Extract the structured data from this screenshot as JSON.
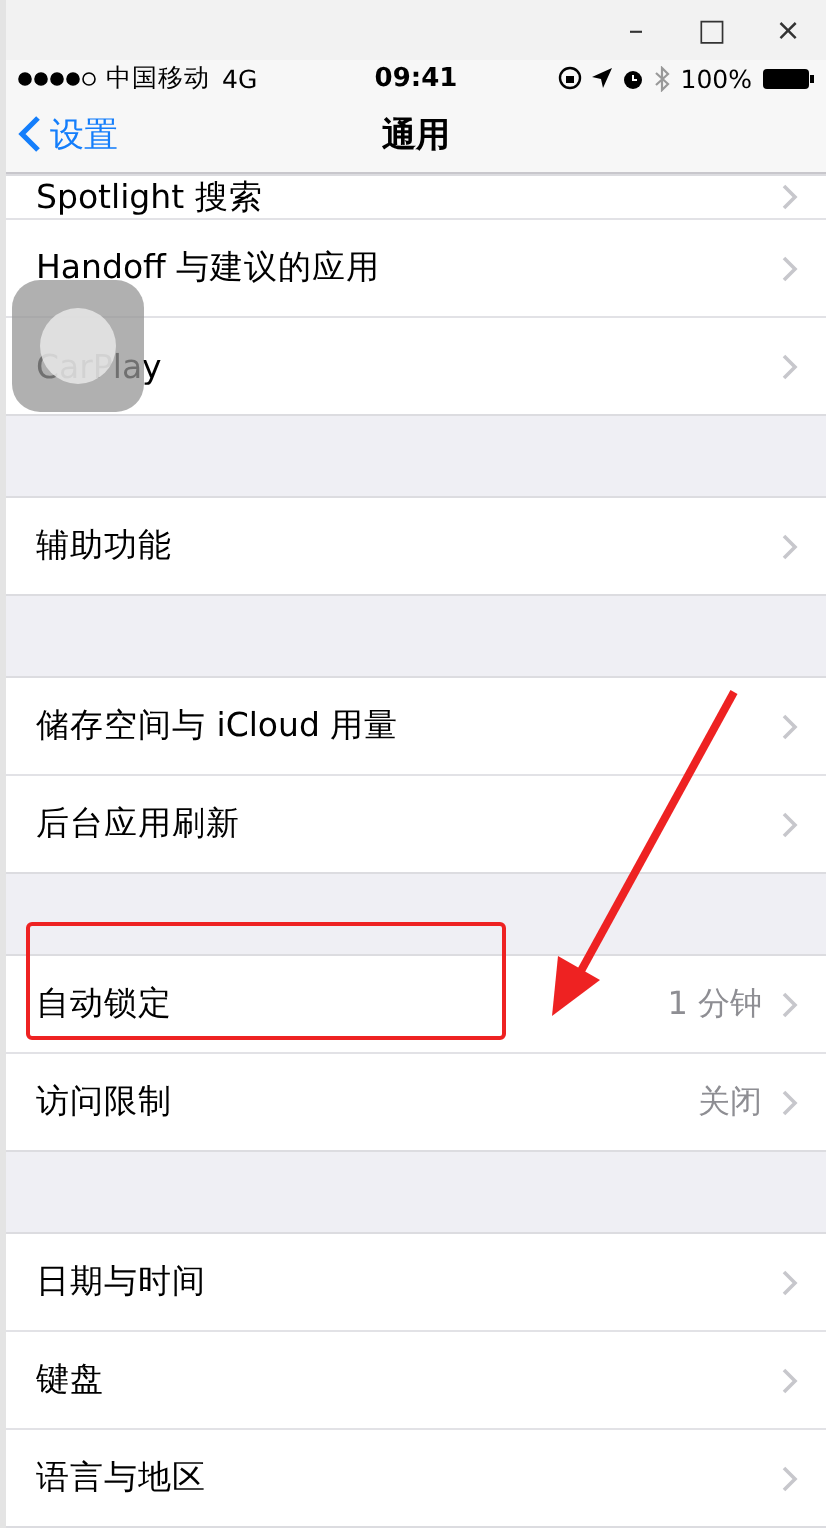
{
  "window": {
    "controls": [
      "–",
      "□",
      "×"
    ]
  },
  "status_bar": {
    "carrier": "中国移动",
    "network": "4G",
    "time": "09:41",
    "battery": "100%"
  },
  "nav_bar": {
    "back": "设置",
    "title": "通用"
  },
  "groups": [
    {
      "rows": [
        {
          "label": "Spotlight 搜索"
        },
        {
          "label": "Handoff 与建议的应用"
        },
        {
          "label": "CarPlay"
        }
      ]
    },
    {
      "rows": [
        {
          "label": "辅助功能"
        }
      ]
    },
    {
      "rows": [
        {
          "label": "储存空间与 iCloud 用量"
        },
        {
          "label": "后台应用刷新"
        }
      ]
    },
    {
      "rows": [
        {
          "label": "自动锁定",
          "value": "1 分钟",
          "highlighted": true
        },
        {
          "label": "访问限制",
          "value": "关闭"
        }
      ]
    },
    {
      "rows": [
        {
          "label": "日期与时间"
        },
        {
          "label": "键盘"
        },
        {
          "label": "语言与地区"
        }
      ]
    }
  ]
}
